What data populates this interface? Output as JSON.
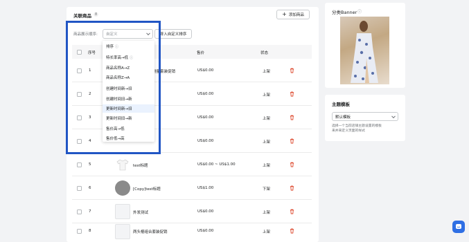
{
  "main": {
    "title": "关联商品",
    "count": "8",
    "add_button": "添加商品",
    "sort_label": "商品展示顺序:",
    "sort_select_value": "自定义",
    "import_button": "导入自定义排序",
    "columns": {
      "index": "序号",
      "price": "售价",
      "status": "状态"
    },
    "rows": [
      {
        "index": "1",
        "name": "测量套装促销",
        "price": "US$0.00",
        "status": "上架"
      },
      {
        "index": "2",
        "name": "",
        "price": "US$0.00",
        "status": "上架"
      },
      {
        "index": "3",
        "name": "",
        "price": "US$0.00",
        "status": "上架"
      },
      {
        "index": "4",
        "name": "",
        "price": "US$0.00",
        "status": "上架"
      },
      {
        "index": "5",
        "name": "test标题",
        "price": "US$0.00 ~ US$1.00",
        "status": "上架"
      },
      {
        "index": "6",
        "name": "[Copy]test标题",
        "price": "US$1.00",
        "status": "下架"
      },
      {
        "index": "7",
        "name": "外发测试",
        "price": "US$0.00",
        "status": "上架"
      },
      {
        "index": "8",
        "name": "两头棍组合套装促销",
        "price": "US$0.00",
        "status": "上架"
      }
    ]
  },
  "dropdown": {
    "items": [
      {
        "label": "排序"
      },
      {
        "label": "特长率高→低"
      },
      {
        "label": "商品名称A→Z"
      },
      {
        "label": "商品名称Z→A"
      },
      {
        "label": "创建时间新→旧"
      },
      {
        "label": "创建时间旧→新"
      },
      {
        "label": "更新时间新→旧"
      },
      {
        "label": "更新时间旧→新"
      },
      {
        "label": "售价高→低"
      },
      {
        "label": "售价低→高"
      }
    ]
  },
  "banner": {
    "title": "分类Banner"
  },
  "theme": {
    "title": "主题模板",
    "select_value": "默认模板",
    "hint_line1": "选择一个当前店铺主题设置的模板",
    "hint_line2": "来并来定义页面的样式"
  },
  "colors": {
    "accent": "#2f6fe4",
    "highlight": "#2155c4",
    "danger": "#d82c0d",
    "active_item": "#eaf2fe"
  }
}
